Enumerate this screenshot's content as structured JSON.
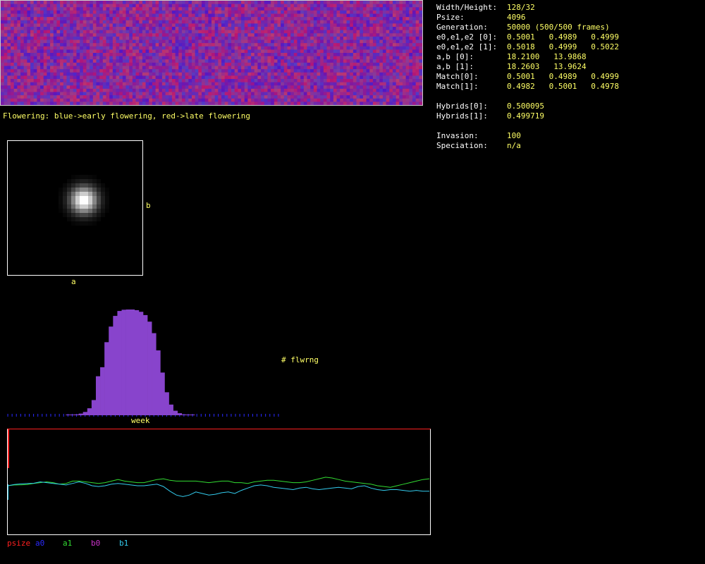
{
  "stats": [
    {
      "label": "Width/Height:",
      "value": "128/32"
    },
    {
      "label": "Psize:",
      "value": "4096"
    },
    {
      "label": "Generation:",
      "value": "50000 (500/500 frames)"
    },
    {
      "label": "e0,e1,e2 [0]:",
      "value": "0.5001   0.4989   0.4999"
    },
    {
      "label": "e0,e1,e2 [1]:",
      "value": "0.5018   0.4999   0.5022"
    },
    {
      "label": "a,b [0]:",
      "value": "18.2100   13.9868"
    },
    {
      "label": "a,b [1]:",
      "value": "18.2603   13.9624"
    },
    {
      "label": "Match[0]:",
      "value": "0.5001   0.4989   0.4999"
    },
    {
      "label": "Match[1]:",
      "value": "0.4982   0.5001   0.4978"
    },
    {
      "label": "",
      "value": ""
    },
    {
      "label": "Hybrids[0]:",
      "value": "0.500095"
    },
    {
      "label": "Hybrids[1]:",
      "value": "0.499719"
    },
    {
      "label": "",
      "value": ""
    },
    {
      "label": "Invasion:",
      "value": "100"
    },
    {
      "label": "Speciation:",
      "value": "n/a"
    }
  ],
  "caption": "Flowering: blue->early flowering, red->late flowering",
  "heatmap": {
    "x_label": "a",
    "y_label": "b"
  },
  "histogram": {
    "x_label": "week",
    "y_label": "# flwrng"
  },
  "timeseries": {
    "legend": [
      {
        "name": "psize",
        "color": "#ff2020"
      },
      {
        "name": "a0",
        "color": "#2a2aff"
      },
      {
        "name": "a1",
        "color": "#33dd33"
      },
      {
        "name": "b0",
        "color": "#cc33cc"
      },
      {
        "name": "b1",
        "color": "#33ccee"
      }
    ]
  },
  "colors": {
    "text": "#ffff66",
    "label": "#ffffff",
    "hist_fill": "#8844cc",
    "grid_low": "#5522cc",
    "grid_high": "#bb2255"
  },
  "chart_data": [
    {
      "type": "bar",
      "x": [
        0,
        1,
        2,
        3,
        4,
        5,
        6,
        7,
        8,
        9,
        10,
        11,
        12,
        13,
        14,
        15,
        16,
        17,
        18,
        19,
        20,
        21,
        22,
        23,
        24,
        25,
        26,
        27,
        28,
        29,
        30,
        31,
        32,
        33,
        34,
        35,
        36,
        37,
        38,
        39,
        40,
        41,
        42,
        43,
        44,
        45,
        46,
        47,
        48,
        49,
        50,
        51,
        52,
        53,
        54,
        55,
        56,
        57,
        58,
        59,
        60,
        61,
        62,
        63
      ],
      "values": [
        0,
        0,
        0,
        0,
        0,
        0,
        0,
        0,
        0,
        0,
        0,
        0,
        0,
        0,
        2,
        5,
        10,
        20,
        40,
        85,
        185,
        475,
        585,
        890,
        1080,
        1210,
        1270,
        1285,
        1288,
        1288,
        1280,
        1260,
        1220,
        1140,
        1000,
        790,
        520,
        280,
        130,
        55,
        25,
        10,
        5,
        2,
        0,
        0,
        0,
        0,
        0,
        0,
        0,
        0,
        0,
        0,
        0,
        0,
        0,
        0,
        0,
        0,
        0,
        0,
        0,
        0
      ],
      "xlabel": "week",
      "ylabel": "# flwrng"
    },
    {
      "type": "line",
      "series": [
        {
          "name": "a1",
          "color": "#33dd33",
          "values": [
            0.0,
            0.5,
            0.6,
            0.8,
            1.5,
            2.0,
            2.5,
            2.0,
            1.0,
            1.5,
            3.0,
            3.0,
            2.5,
            2.0,
            1.5,
            2.0,
            3.0,
            4.0,
            3.0,
            2.5,
            2.0,
            2.0,
            3.0,
            4.0,
            4.5,
            3.5,
            3.0,
            3.0,
            3.0,
            3.0,
            2.5,
            2.0,
            2.5,
            3.0,
            3.0,
            2.0,
            2.0,
            1.5,
            2.5,
            3.0,
            3.5,
            3.5,
            3.0,
            2.5,
            2.0,
            2.0,
            2.5,
            3.5,
            4.5,
            5.5,
            5.0,
            4.0,
            3.0,
            2.5,
            2.0,
            1.5,
            1.0,
            0.0,
            -0.5,
            -1.0,
            0.0,
            1.0,
            2.0,
            3.0,
            4.0,
            4.5
          ]
        },
        {
          "name": "b1",
          "color": "#33ccee",
          "values": [
            0.0,
            0.8,
            1.2,
            1.4,
            1.6,
            2.5,
            2.0,
            1.5,
            1.0,
            0.5,
            1.5,
            2.5,
            1.5,
            0.0,
            -0.5,
            0.0,
            1.0,
            1.5,
            1.0,
            0.5,
            0.0,
            0.0,
            0.5,
            1.0,
            -0.5,
            -3.5,
            -6.0,
            -7.0,
            -6.0,
            -4.0,
            -5.0,
            -6.0,
            -5.5,
            -4.5,
            -4.0,
            -5.0,
            -3.0,
            -1.5,
            0.0,
            0.5,
            0.0,
            -1.0,
            -1.5,
            -2.0,
            -2.5,
            -1.5,
            -1.0,
            -2.0,
            -2.5,
            -2.0,
            -1.5,
            -1.0,
            -1.5,
            -2.0,
            -0.5,
            0.0,
            -1.5,
            -2.5,
            -3.0,
            -2.5,
            -2.5,
            -3.0,
            -3.5,
            -3.0,
            -3.5,
            -3.5
          ]
        }
      ]
    }
  ]
}
